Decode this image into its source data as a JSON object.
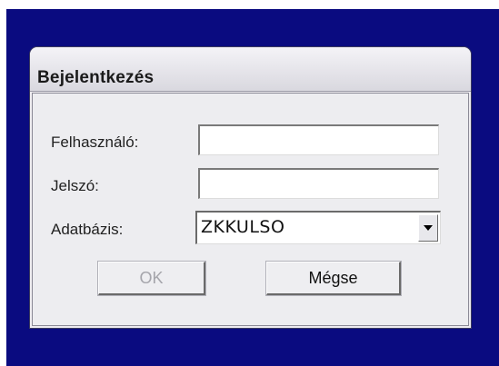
{
  "dialog": {
    "title": "Bejelentkezés",
    "fields": {
      "user_label": "Felhasználó:",
      "user_value": "",
      "password_label": "Jelszó:",
      "password_value": "",
      "database_label": "Adatbázis:",
      "database_value": "ZKKULSO"
    },
    "buttons": {
      "ok_label": "OK",
      "ok_enabled": false,
      "cancel_label": "Mégse"
    }
  },
  "colors": {
    "backdrop": "#0a0b80",
    "dialog_bg": "#eeecf0",
    "disabled_text": "#a5a5ab"
  },
  "icons": {
    "dropdown": "chevron-down-icon"
  }
}
